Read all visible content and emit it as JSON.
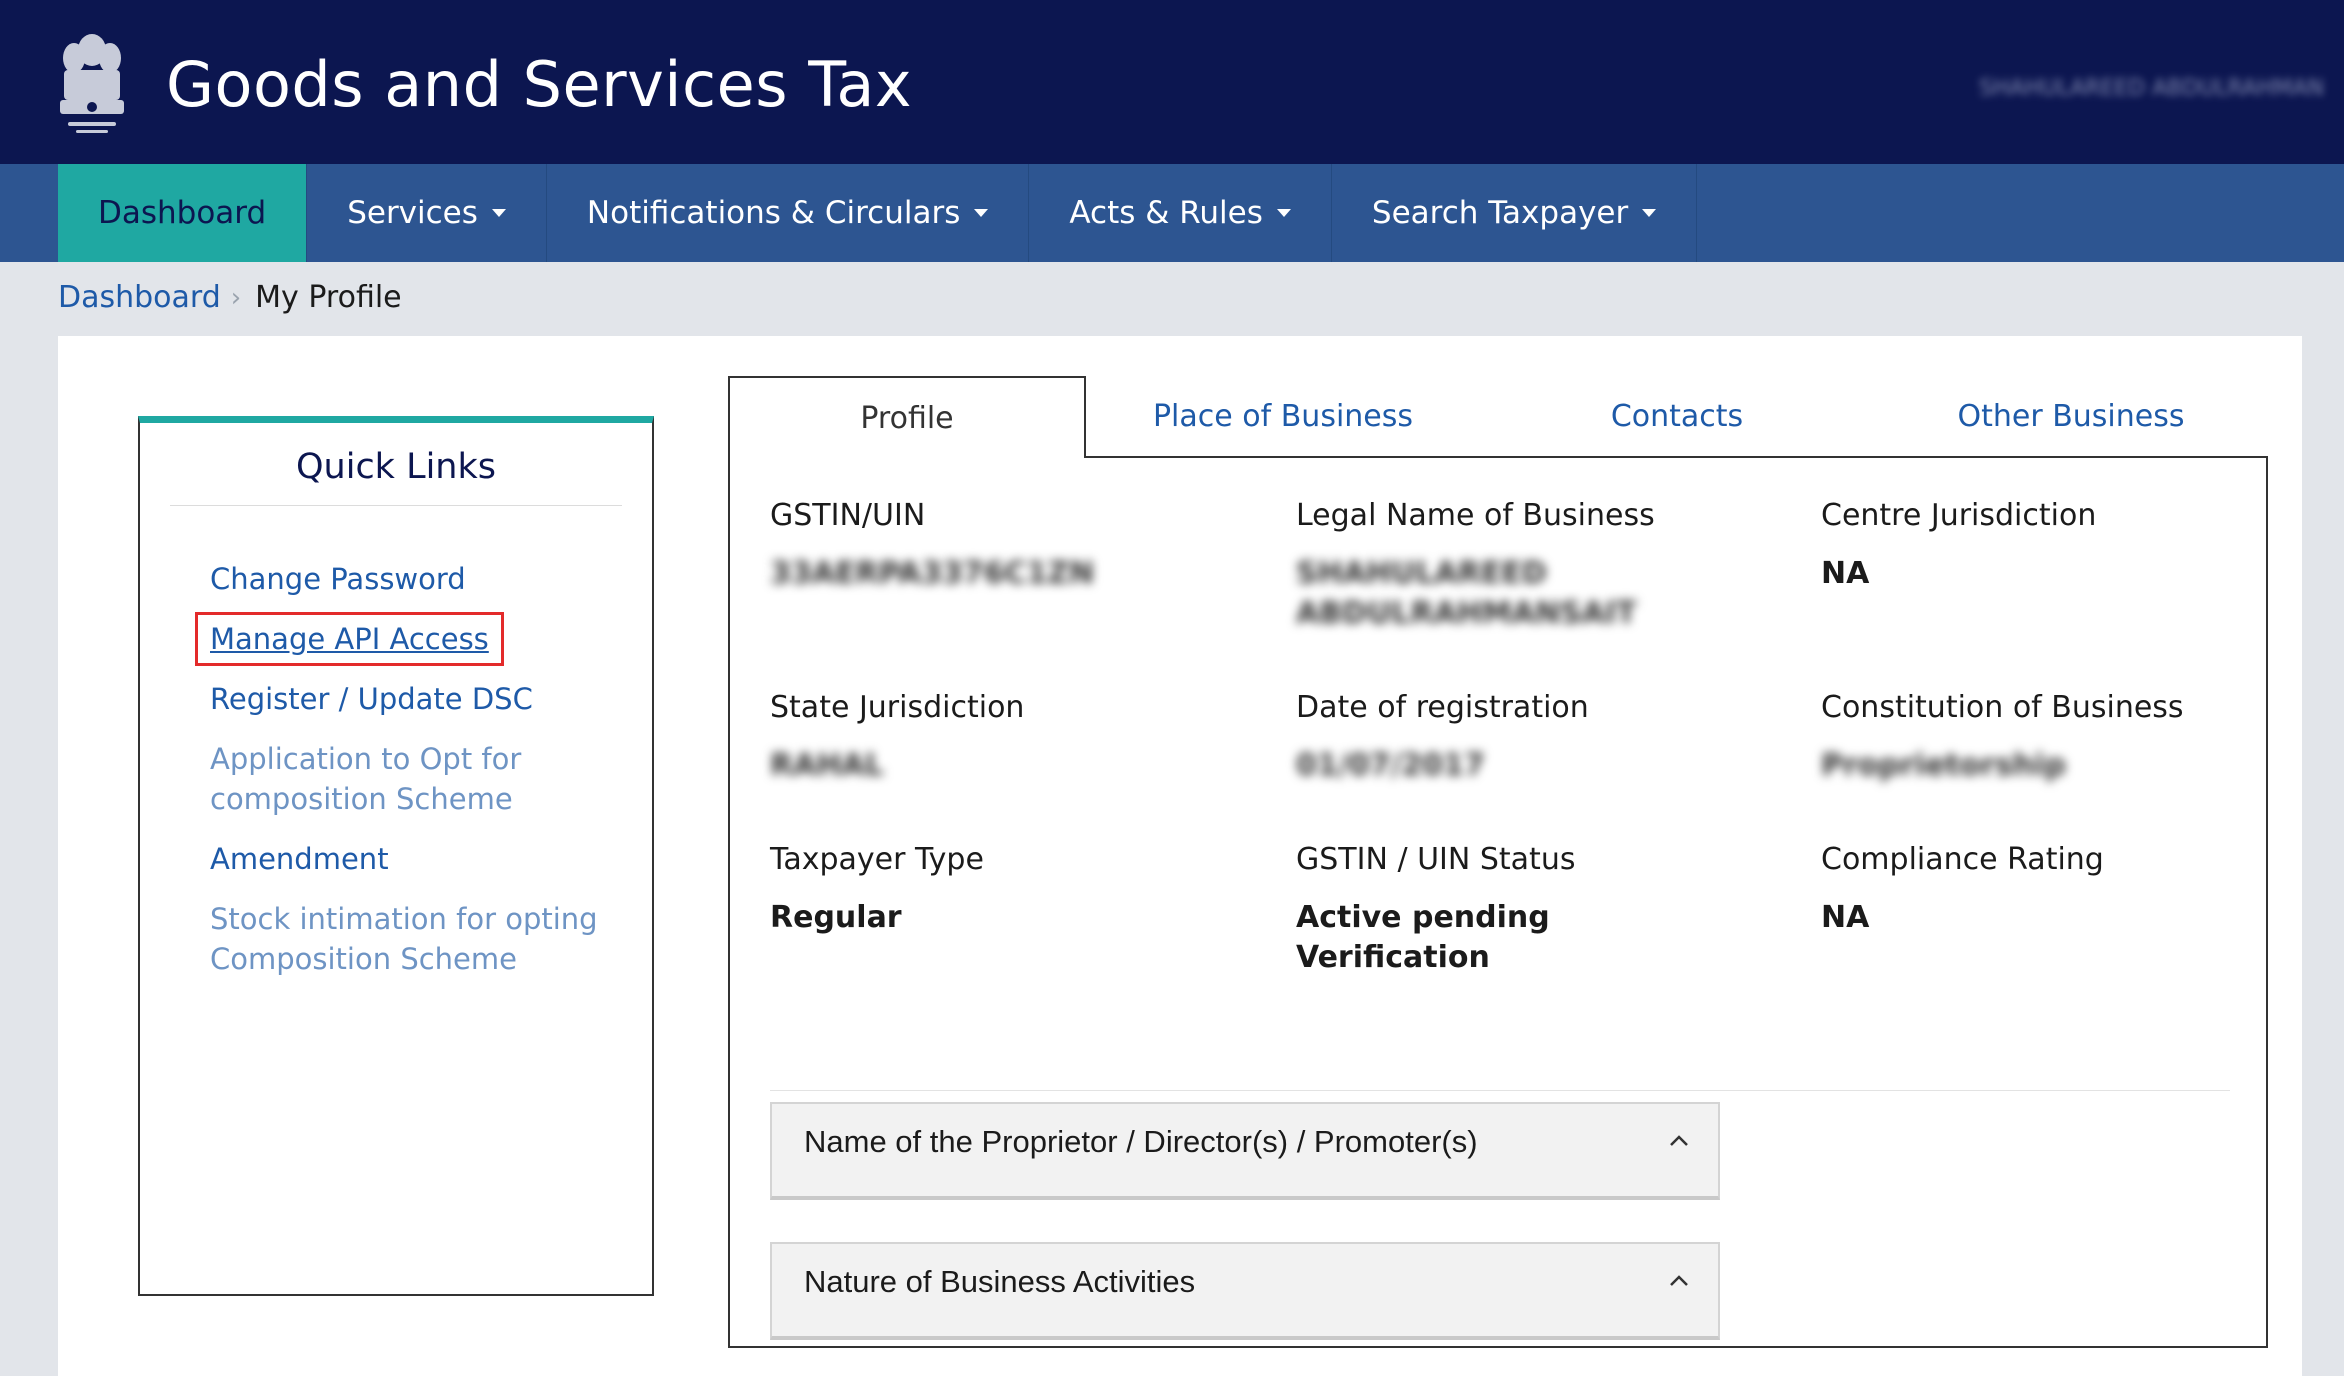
{
  "header": {
    "title": "Goods and Services Tax",
    "user_name": "SHAHULAREED ABDULRAHMAN"
  },
  "nav": {
    "items": [
      {
        "label": "Dashboard",
        "active": true,
        "has_caret": false
      },
      {
        "label": "Services",
        "active": false,
        "has_caret": true
      },
      {
        "label": "Notifications & Circulars",
        "active": false,
        "has_caret": true
      },
      {
        "label": "Acts & Rules",
        "active": false,
        "has_caret": true
      },
      {
        "label": "Search Taxpayer",
        "active": false,
        "has_caret": true
      }
    ]
  },
  "breadcrumb": {
    "root": "Dashboard",
    "current": "My Profile"
  },
  "quick_links": {
    "title": "Quick Links",
    "items": [
      {
        "label": "Change Password"
      },
      {
        "label": "Manage API Access"
      },
      {
        "label": "Register / Update DSC"
      },
      {
        "label": "Application to Opt for composition Scheme"
      },
      {
        "label": "Amendment"
      },
      {
        "label": "Stock intimation for opting Composition Scheme"
      }
    ]
  },
  "tabs": {
    "items": [
      {
        "label": "Profile"
      },
      {
        "label": "Place of Business"
      },
      {
        "label": "Contacts"
      },
      {
        "label": "Other Business"
      }
    ],
    "active": "Profile"
  },
  "profile": {
    "gstin_label": "GSTIN/UIN",
    "gstin_value": "33AERPA3376C1ZN",
    "legal_name_label": "Legal Name of Business",
    "legal_name_value_1": "SHAHULAREED",
    "legal_name_value_2": "ABDULRAHMANSAIT",
    "centre_juris_label": "Centre Jurisdiction",
    "centre_juris_value": "NA",
    "state_juris_label": "State Jurisdiction",
    "state_juris_value": "RAHAL",
    "reg_date_label": "Date of registration",
    "reg_date_value": "01/07/2017",
    "constitution_label": "Constitution of Business",
    "constitution_value": "Proprietorship",
    "taxpayer_type_label": "Taxpayer Type",
    "taxpayer_type_value": "Regular",
    "status_label": "GSTIN / UIN Status",
    "status_value_1": "Active pending",
    "status_value_2": "Verification",
    "compliance_label": "Compliance Rating",
    "compliance_value": "NA"
  },
  "accordions": {
    "proprietor": "Name of the Proprietor / Director(s) / Promoter(s)",
    "nature": "Nature of Business Activities"
  },
  "icons": {
    "emblem": "national-emblem-icon",
    "caret": "caret-down-icon",
    "chevron": "chevron-up-icon"
  },
  "colors": {
    "header_bg": "#0c1650",
    "nav_bg": "#2d5591",
    "active_nav": "#1fa8a2",
    "link": "#1e5aa8",
    "highlight_box": "#e32a2a"
  }
}
